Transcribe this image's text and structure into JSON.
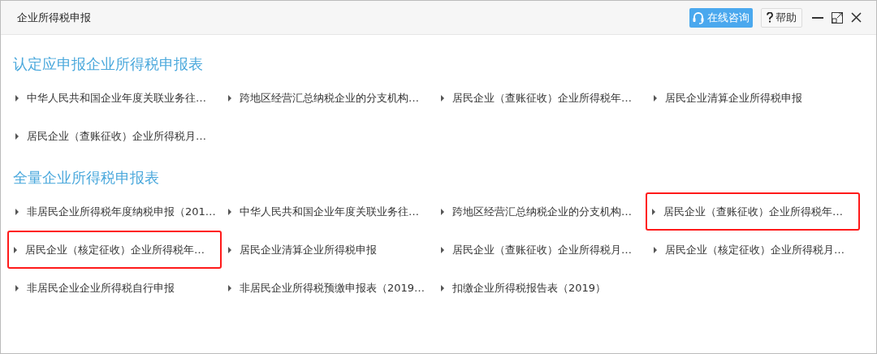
{
  "window": {
    "title": "企业所得税申报",
    "buttons": [
      {
        "kind": "consult",
        "label": "在线咨询"
      },
      {
        "kind": "help",
        "label": "帮助"
      }
    ]
  },
  "sections": [
    {
      "title": "认定应申报企业所得税申报表",
      "items": [
        {
          "label": "中华人民共和国企业年度关联业务往…",
          "highlighted": false
        },
        {
          "label": "跨地区经营汇总纳税企业的分支机构…",
          "highlighted": false
        },
        {
          "label": "居民企业（查账征收）企业所得税年…",
          "highlighted": false
        },
        {
          "label": "居民企业清算企业所得税申报",
          "highlighted": false
        },
        {
          "label": "居民企业（查账征收）企业所得税月…",
          "highlighted": false
        }
      ]
    },
    {
      "title": "全量企业所得税申报表",
      "items": [
        {
          "label": "非居民企业所得税年度纳税申报（201…",
          "highlighted": false
        },
        {
          "label": "中华人民共和国企业年度关联业务往…",
          "highlighted": false
        },
        {
          "label": "跨地区经营汇总纳税企业的分支机构…",
          "highlighted": false
        },
        {
          "label": "居民企业（查账征收）企业所得税年…",
          "highlighted": true
        },
        {
          "label": "居民企业（核定征收）企业所得税年…",
          "highlighted": true
        },
        {
          "label": "居民企业清算企业所得税申报",
          "highlighted": false
        },
        {
          "label": "居民企业（查账征收）企业所得税月…",
          "highlighted": false
        },
        {
          "label": "居民企业（核定征收）企业所得税月…",
          "highlighted": false
        },
        {
          "label": "非居民企业企业所得税自行申报",
          "highlighted": false
        },
        {
          "label": "非居民企业所得税预缴申报表（2019…",
          "highlighted": false
        },
        {
          "label": "扣缴企业所得税报告表（2019）",
          "highlighted": false
        }
      ]
    }
  ]
}
